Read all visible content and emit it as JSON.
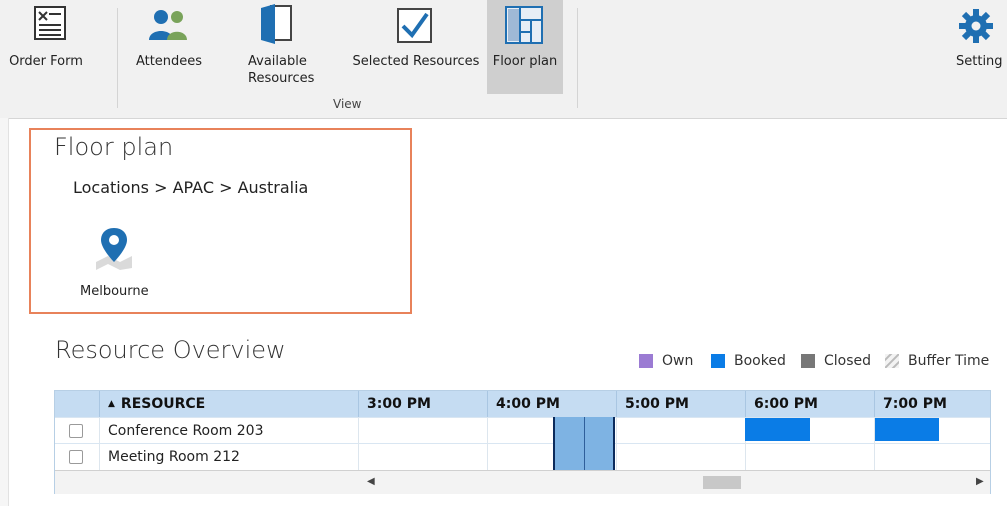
{
  "ribbon": {
    "buttons": [
      {
        "id": "order_form",
        "label": "Order Form"
      },
      {
        "id": "attendees",
        "label": "Attendees"
      },
      {
        "id": "available",
        "label": "Available Resources"
      },
      {
        "id": "selected",
        "label": "Selected Resources"
      },
      {
        "id": "floor_plan",
        "label": "Floor plan",
        "active": true
      },
      {
        "id": "settings",
        "label": "Setting"
      }
    ],
    "group_label": "View"
  },
  "floor_plan": {
    "title": "Floor plan",
    "breadcrumb": "Locations > APAC > Australia",
    "location_label": "Melbourne"
  },
  "resource_overview": {
    "title": "Resource Overview",
    "legend": [
      {
        "label": "Own",
        "color": "#9b7bd3"
      },
      {
        "label": "Booked",
        "color": "#0a7ce6"
      },
      {
        "label": "Closed",
        "color": "#777777"
      },
      {
        "label": "Buffer Time",
        "color": "#bbbbbb"
      }
    ],
    "columns": {
      "resource": "RESOURCE",
      "sort_glyph": "▲",
      "times": [
        "3:00 PM",
        "4:00 PM",
        "5:00 PM",
        "6:00 PM",
        "7:00 PM"
      ]
    },
    "rows": [
      {
        "name": "Conference Room 203"
      },
      {
        "name": "Meeting Room 212"
      }
    ]
  },
  "colors": {
    "accent": "#0a7ce6",
    "highlight_border": "#e8825a",
    "grid_header": "#c5dcf2"
  }
}
